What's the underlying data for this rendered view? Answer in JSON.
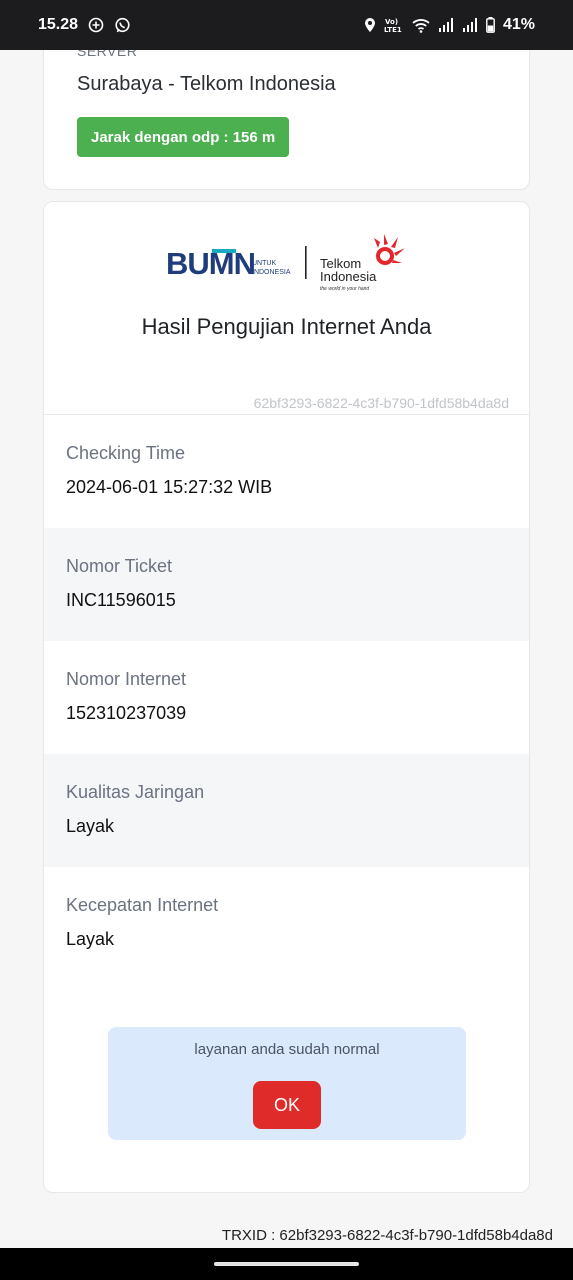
{
  "statusbar": {
    "time": "15.28",
    "volte_label": "Vo\nLTE1",
    "battery_percent": "41%",
    "icons": [
      "add-circle-icon",
      "whatsapp-icon",
      "location-icon",
      "volte-icon",
      "wifi-icon",
      "signal-icon",
      "signal-icon",
      "battery-icon"
    ]
  },
  "server": {
    "label": "SERVER",
    "value": "Surabaya - Telkom Indonesia",
    "badge": "Jarak dengan odp : 156 m"
  },
  "result": {
    "logo": {
      "bumn_text": "BUMN",
      "bumn_sub1": "UNTUK",
      "bumn_sub2": "INDONESIA",
      "telkom_line1": "Telkom",
      "telkom_line2": "Indonesia",
      "telkom_tagline": "the world in your hand"
    },
    "title": "Hasil Pengujian Internet Anda",
    "uuid": "62bf3293-6822-4c3f-b790-1dfd58b4da8d",
    "rows": [
      {
        "label": "Checking Time",
        "value": "2024-06-01 15:27:32 WIB"
      },
      {
        "label": "Nomor Ticket",
        "value": "INC11596015"
      },
      {
        "label": "Nomor Internet",
        "value": "152310237039"
      },
      {
        "label": "Kualitas Jaringan",
        "value": "Layak"
      },
      {
        "label": "Kecepatan Internet",
        "value": "Layak"
      }
    ],
    "alert": {
      "message": "layanan anda sudah normal",
      "button": "OK"
    }
  },
  "footer": {
    "trxid": "TRXID : 62bf3293-6822-4c3f-b790-1dfd58b4da8d"
  },
  "colors": {
    "badge_green": "#4caf50",
    "ok_red": "#e02b2b",
    "alert_bg": "#dbe9fc",
    "bumn_blue": "#1f3d7a",
    "bumn_teal": "#19a9c0",
    "telkom_red": "#e4262b"
  }
}
